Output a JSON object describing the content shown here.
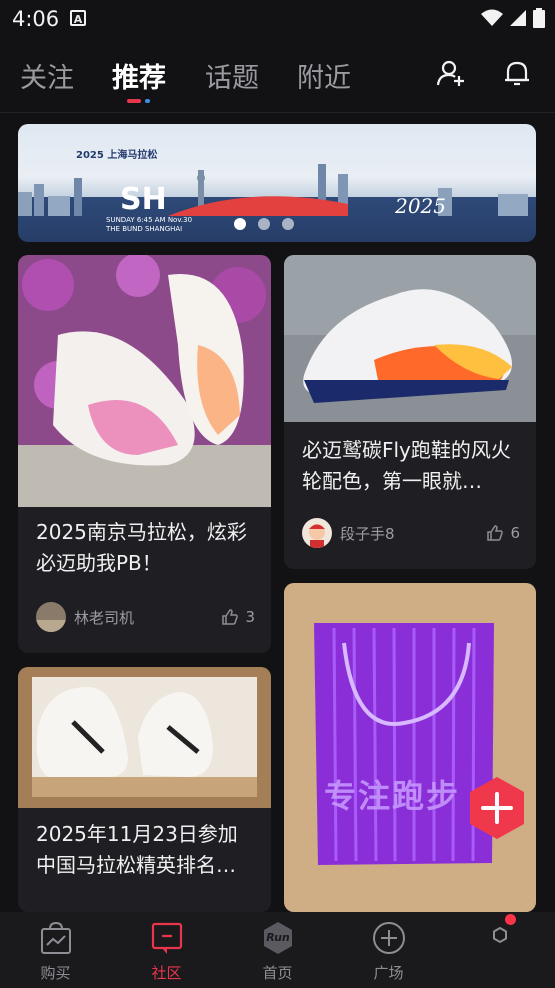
{
  "status_bar": {
    "time": "4:06",
    "badge": "A"
  },
  "top_tabs": [
    {
      "label": "关注"
    },
    {
      "label": "推荐",
      "active": true
    },
    {
      "label": "话题"
    },
    {
      "label": "附近"
    }
  ],
  "banner": {
    "logo_text": "2025 上海马拉松",
    "headline": "SH",
    "subline_1": "SUNDAY 6:45 AM Nov.30",
    "subline_2": "THE BUND SHANGHAI",
    "year": "2025",
    "slide_count": 3
  },
  "posts": [
    {
      "title": "2025南京马拉松，炫彩必迈助我PB！",
      "author": "林老司机",
      "likes": "3"
    },
    {
      "title": "必迈鹫碳Fly跑鞋的风火轮配色，第一眼就…",
      "author": "段子手8",
      "likes": "6"
    },
    {
      "title": "2025年11月23日参加中国马拉松精英排名…",
      "author": "",
      "likes": ""
    },
    {
      "title": "",
      "author": "",
      "likes": "",
      "image_text": "专注跑步"
    }
  ],
  "bottom_nav": [
    {
      "label": "购买"
    },
    {
      "label": "社区",
      "active": true
    },
    {
      "label": "首页",
      "badge_text": "Run"
    },
    {
      "label": "广场"
    },
    {
      "label": ""
    }
  ],
  "colors": {
    "accent": "#e8364a",
    "background": "#121214",
    "card": "#1f1f23"
  }
}
